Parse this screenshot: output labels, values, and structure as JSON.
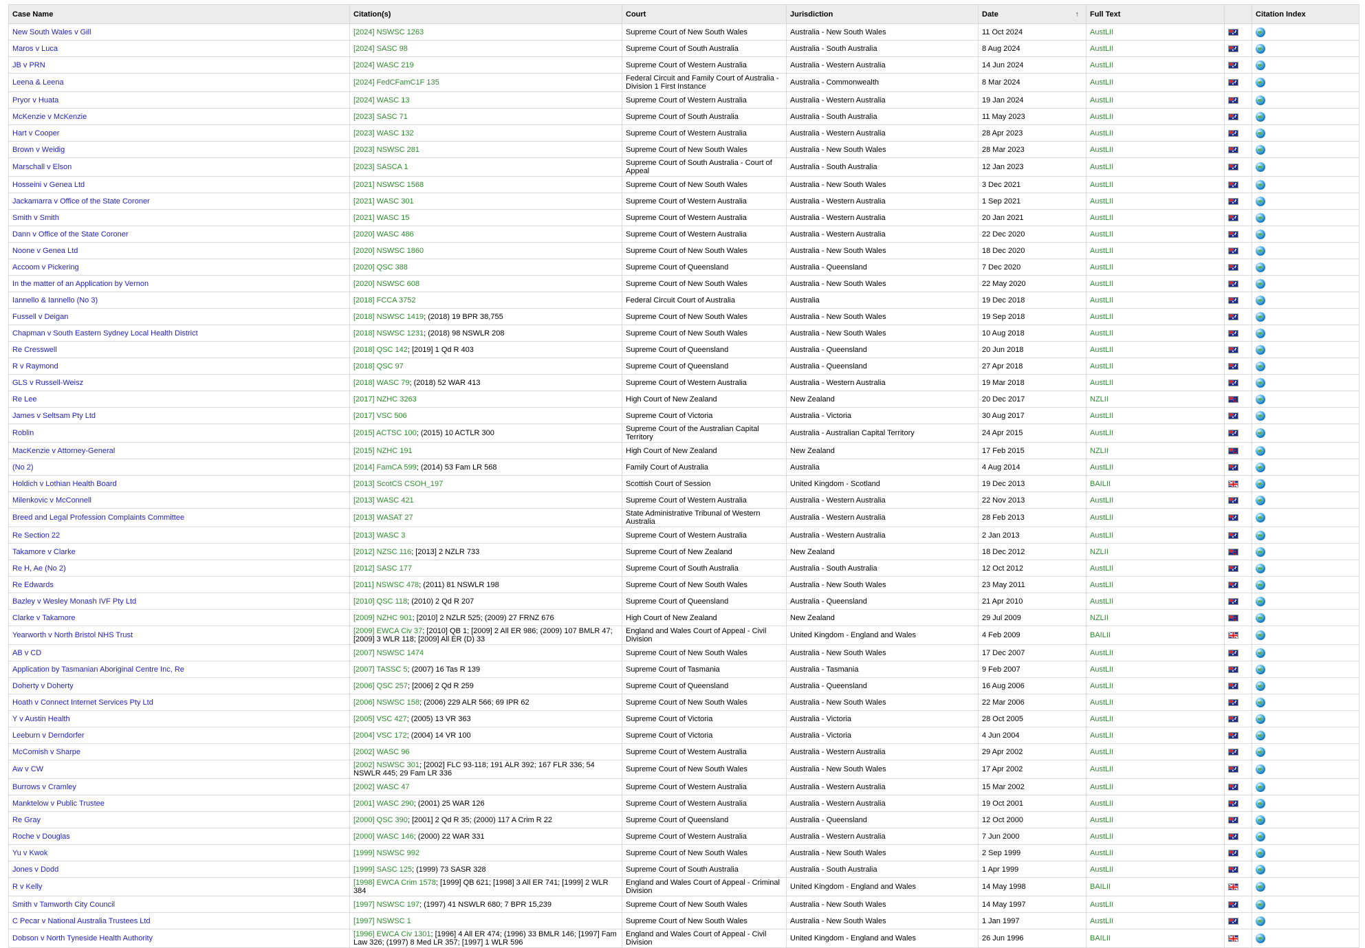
{
  "headers": {
    "case_name": "Case Name",
    "citations": "Citation(s)",
    "court": "Court",
    "jurisdiction": "Jurisdiction",
    "date": "Date",
    "date_sort_icon": "↑",
    "full_text": "Full Text",
    "flag": "",
    "citation_index": "Citation Index"
  },
  "icons": {
    "country_flag": "flag-icon",
    "citation_index": "globe-icon"
  },
  "rows": [
    {
      "name": "New South Wales v Gill",
      "cite_link": "[2024] NSWSC 1263",
      "cite_rest": "",
      "court": "Supreme Court of New South Wales",
      "jurisdiction": "Australia - New South Wales",
      "date": "11 Oct 2024",
      "full_text": "AustLII",
      "flag": "au"
    },
    {
      "name": "Maros v Luca",
      "cite_link": "[2024] SASC 98",
      "cite_rest": "",
      "court": "Supreme Court of South Australia",
      "jurisdiction": "Australia - South Australia",
      "date": "8 Aug 2024",
      "full_text": "AustLII",
      "flag": "au"
    },
    {
      "name": "JB v PRN",
      "cite_link": "[2024] WASC 219",
      "cite_rest": "",
      "court": "Supreme Court of Western Australia",
      "jurisdiction": "Australia - Western Australia",
      "date": "14 Jun 2024",
      "full_text": "AustLII",
      "flag": "au"
    },
    {
      "name": "Leena & Leena",
      "cite_link": "[2024] FedCFamC1F 135",
      "cite_rest": "",
      "court": "Federal Circuit and Family Court of Australia - Division 1 First Instance",
      "jurisdiction": "Australia - Commonwealth",
      "date": "8 Mar 2024",
      "full_text": "AustLII",
      "flag": "au",
      "tall": true
    },
    {
      "name": "Pryor v Huata",
      "cite_link": "[2024] WASC 13",
      "cite_rest": "",
      "court": "Supreme Court of Western Australia",
      "jurisdiction": "Australia - Western Australia",
      "date": "19 Jan 2024",
      "full_text": "AustLII",
      "flag": "au"
    },
    {
      "name": "McKenzie v McKenzie",
      "cite_link": "[2023] SASC 71",
      "cite_rest": "",
      "court": "Supreme Court of South Australia",
      "jurisdiction": "Australia - South Australia",
      "date": "11 May 2023",
      "full_text": "AustLII",
      "flag": "au"
    },
    {
      "name": "Hart v Cooper",
      "cite_link": "[2023] WASC 132",
      "cite_rest": "",
      "court": "Supreme Court of Western Australia",
      "jurisdiction": "Australia - Western Australia",
      "date": "28 Apr 2023",
      "full_text": "AustLII",
      "flag": "au"
    },
    {
      "name": "Brown v Weidig",
      "cite_link": "[2023] NSWSC 281",
      "cite_rest": "",
      "court": "Supreme Court of New South Wales",
      "jurisdiction": "Australia - New South Wales",
      "date": "28 Mar 2023",
      "full_text": "AustLII",
      "flag": "au"
    },
    {
      "name": "Marschall v Elson",
      "cite_link": "[2023] SASCA 1",
      "cite_rest": "",
      "court": "Supreme Court of South Australia - Court of Appeal",
      "jurisdiction": "Australia - South Australia",
      "date": "12 Jan 2023",
      "full_text": "AustLII",
      "flag": "au",
      "tall": true
    },
    {
      "name": "Hosseini v Genea Ltd",
      "cite_link": "[2021] NSWSC 1568",
      "cite_rest": "",
      "court": "Supreme Court of New South Wales",
      "jurisdiction": "Australia - New South Wales",
      "date": "3 Dec 2021",
      "full_text": "AustLII",
      "flag": "au"
    },
    {
      "name": "Jackamarra v Office of the State Coroner",
      "cite_link": "[2021] WASC 301",
      "cite_rest": "",
      "court": "Supreme Court of Western Australia",
      "jurisdiction": "Australia - Western Australia",
      "date": "1 Sep 2021",
      "full_text": "AustLII",
      "flag": "au"
    },
    {
      "name": "Smith v Smith",
      "cite_link": "[2021] WASC 15",
      "cite_rest": "",
      "court": "Supreme Court of Western Australia",
      "jurisdiction": "Australia - Western Australia",
      "date": "20 Jan 2021",
      "full_text": "AustLII",
      "flag": "au"
    },
    {
      "name": "Dann v Office of the State Coroner",
      "cite_link": "[2020] WASC 486",
      "cite_rest": "",
      "court": "Supreme Court of Western Australia",
      "jurisdiction": "Australia - Western Australia",
      "date": "22 Dec 2020",
      "full_text": "AustLII",
      "flag": "au"
    },
    {
      "name": "Noone v Genea Ltd",
      "cite_link": "[2020] NSWSC 1860",
      "cite_rest": "",
      "court": "Supreme Court of New South Wales",
      "jurisdiction": "Australia - New South Wales",
      "date": "18 Dec 2020",
      "full_text": "AustLII",
      "flag": "au"
    },
    {
      "name": "Accoom v Pickering",
      "cite_link": "[2020] QSC 388",
      "cite_rest": "",
      "court": "Supreme Court of Queensland",
      "jurisdiction": "Australia - Queensland",
      "date": "7 Dec 2020",
      "full_text": "AustLII",
      "flag": "au"
    },
    {
      "name": "In the matter of an Application by Vernon",
      "cite_link": "[2020] NSWSC 608",
      "cite_rest": "",
      "court": "Supreme Court of New South Wales",
      "jurisdiction": "Australia - New South Wales",
      "date": "22 May 2020",
      "full_text": "AustLII",
      "flag": "au"
    },
    {
      "name": "Iannello & Iannello (No 3)",
      "cite_link": "[2018] FCCA 3752",
      "cite_rest": "",
      "court": "Federal Circuit Court of Australia",
      "jurisdiction": "Australia",
      "date": "19 Dec 2018",
      "full_text": "AustLII",
      "flag": "au"
    },
    {
      "name": "Fussell v Deigan",
      "cite_link": "[2018] NSWSC 1419",
      "cite_rest": "; (2018) 19 BPR 38,755",
      "court": "Supreme Court of New South Wales",
      "jurisdiction": "Australia - New South Wales",
      "date": "19 Sep 2018",
      "full_text": "AustLII",
      "flag": "au"
    },
    {
      "name": "Chapman v South Eastern Sydney Local Health District",
      "cite_link": "[2018] NSWSC 1231",
      "cite_rest": "; (2018) 98 NSWLR 208",
      "court": "Supreme Court of New South Wales",
      "jurisdiction": "Australia - New South Wales",
      "date": "10 Aug 2018",
      "full_text": "AustLII",
      "flag": "au"
    },
    {
      "name": "Re Cresswell",
      "cite_link": "[2018] QSC 142",
      "cite_rest": "; [2019] 1 Qd R 403",
      "court": "Supreme Court of Queensland",
      "jurisdiction": "Australia - Queensland",
      "date": "20 Jun 2018",
      "full_text": "AustLII",
      "flag": "au"
    },
    {
      "name": "R v Raymond",
      "cite_link": "[2018] QSC 97",
      "cite_rest": "",
      "court": "Supreme Court of Queensland",
      "jurisdiction": "Australia - Queensland",
      "date": "27 Apr 2018",
      "full_text": "AustLII",
      "flag": "au"
    },
    {
      "name": "GLS v Russell-Weisz",
      "cite_link": "[2018] WASC 79",
      "cite_rest": "; (2018) 52 WAR 413",
      "court": "Supreme Court of Western Australia",
      "jurisdiction": "Australia - Western Australia",
      "date": "19 Mar 2018",
      "full_text": "AustLII",
      "flag": "au"
    },
    {
      "name": "Re Lee",
      "cite_link": "[2017] NZHC 3263",
      "cite_rest": "",
      "court": "High Court of New Zealand",
      "jurisdiction": "New Zealand",
      "date": "20 Dec 2017",
      "full_text": "NZLII",
      "flag": "nz"
    },
    {
      "name": "James v Seltsam Pty Ltd",
      "cite_link": "[2017] VSC 506",
      "cite_rest": "",
      "court": "Supreme Court of Victoria",
      "jurisdiction": "Australia - Victoria",
      "date": "30 Aug 2017",
      "full_text": "AustLII",
      "flag": "au"
    },
    {
      "name": "Roblin",
      "cite_link": "[2015] ACTSC 100",
      "cite_rest": "; (2015) 10 ACTLR 300",
      "court": "Supreme Court of the Australian Capital Territory",
      "jurisdiction": "Australia - Australian Capital Territory",
      "date": "24 Apr 2015",
      "full_text": "AustLII",
      "flag": "au",
      "tall": true
    },
    {
      "name": "MacKenzie v Attorney-General",
      "cite_link": "[2015] NZHC 191",
      "cite_rest": "",
      "court": "High Court of New Zealand",
      "jurisdiction": "New Zealand",
      "date": "17 Feb 2015",
      "full_text": "NZLII",
      "flag": "nz"
    },
    {
      "name": "(No 2)",
      "cite_link": "[2014] FamCA 599",
      "cite_rest": "; (2014) 53 Fam LR 568",
      "court": "Family Court of Australia",
      "jurisdiction": "Australia",
      "date": "4 Aug 2014",
      "full_text": "AustLII",
      "flag": "au"
    },
    {
      "name": "Holdich v Lothian Health Board",
      "cite_link": "[2013] ScotCS CSOH_197",
      "cite_rest": "",
      "court": "Scottish Court of Session",
      "jurisdiction": "United Kingdom - Scotland",
      "date": "19 Dec 2013",
      "full_text": "BAILII",
      "flag": "uk"
    },
    {
      "name": "Milenkovic v McConnell",
      "cite_link": "[2013] WASC 421",
      "cite_rest": "",
      "court": "Supreme Court of Western Australia",
      "jurisdiction": "Australia - Western Australia",
      "date": "22 Nov 2013",
      "full_text": "AustLII",
      "flag": "au"
    },
    {
      "name": "Breed and Legal Profession Complaints Committee",
      "cite_link": "[2013] WASAT 27",
      "cite_rest": "",
      "court": "State Administrative Tribunal of Western Australia",
      "jurisdiction": "Australia - Western Australia",
      "date": "28 Feb 2013",
      "full_text": "AustLII",
      "flag": "au",
      "tall": true
    },
    {
      "name": "Re Section 22",
      "cite_link": "[2013] WASC 3",
      "cite_rest": "",
      "court": "Supreme Court of Western Australia",
      "jurisdiction": "Australia - Western Australia",
      "date": "2 Jan 2013",
      "full_text": "AustLII",
      "flag": "au"
    },
    {
      "name": "Takamore v Clarke",
      "cite_link": "[2012] NZSC 116",
      "cite_rest": "; [2013] 2 NZLR 733",
      "court": "Supreme Court of New Zealand",
      "jurisdiction": "New Zealand",
      "date": "18 Dec 2012",
      "full_text": "NZLII",
      "flag": "nz"
    },
    {
      "name": "Re H, Ae (No 2)",
      "cite_link": "[2012] SASC 177",
      "cite_rest": "",
      "court": "Supreme Court of South Australia",
      "jurisdiction": "Australia - South Australia",
      "date": "12 Oct 2012",
      "full_text": "AustLII",
      "flag": "au"
    },
    {
      "name": "Re Edwards",
      "cite_link": "[2011] NSWSC 478",
      "cite_rest": "; (2011) 81 NSWLR 198",
      "court": "Supreme Court of New South Wales",
      "jurisdiction": "Australia - New South Wales",
      "date": "23 May 2011",
      "full_text": "AustLII",
      "flag": "au"
    },
    {
      "name": "Bazley v Wesley Monash IVF Pty Ltd",
      "cite_link": "[2010] QSC 118",
      "cite_rest": "; (2010) 2 Qd R 207",
      "court": "Supreme Court of Queensland",
      "jurisdiction": "Australia - Queensland",
      "date": "21 Apr 2010",
      "full_text": "AustLII",
      "flag": "au"
    },
    {
      "name": "Clarke v Takamore",
      "cite_link": "[2009] NZHC 901",
      "cite_rest": "; [2010] 2 NZLR 525; (2009) 27 FRNZ 676",
      "court": "High Court of New Zealand",
      "jurisdiction": "New Zealand",
      "date": "29 Jul 2009",
      "full_text": "NZLII",
      "flag": "nz"
    },
    {
      "name": "Yearworth v North Bristol NHS Trust",
      "cite_link": "[2009] EWCA Civ 37",
      "cite_rest": "; [2010] QB 1; [2009] 2 All ER 986; (2009) 107 BMLR 47; [2009] 3 WLR 118; [2009] All ER (D) 33",
      "court": "England and Wales Court of Appeal - Civil Division",
      "jurisdiction": "United Kingdom - England and Wales",
      "date": "4 Feb 2009",
      "full_text": "BAILII",
      "flag": "uk",
      "tall": true
    },
    {
      "name": "AB v CD",
      "cite_link": "[2007] NSWSC 1474",
      "cite_rest": "",
      "court": "Supreme Court of New South Wales",
      "jurisdiction": "Australia - New South Wales",
      "date": "17 Dec 2007",
      "full_text": "AustLII",
      "flag": "au"
    },
    {
      "name": "Application by Tasmanian Aboriginal Centre Inc, Re",
      "cite_link": "[2007] TASSC 5",
      "cite_rest": "; (2007) 16 Tas R 139",
      "court": "Supreme Court of Tasmania",
      "jurisdiction": "Australia - Tasmania",
      "date": "9 Feb 2007",
      "full_text": "AustLII",
      "flag": "au"
    },
    {
      "name": "Doherty v Doherty",
      "cite_link": "[2006] QSC 257",
      "cite_rest": "; [2006] 2 Qd R 259",
      "court": "Supreme Court of Queensland",
      "jurisdiction": "Australia - Queensland",
      "date": "16 Aug 2006",
      "full_text": "AustLII",
      "flag": "au"
    },
    {
      "name": "Hoath v Connect Internet Services Pty Ltd",
      "cite_link": "[2006] NSWSC 158",
      "cite_rest": "; (2006) 229 ALR 566; 69 IPR 62",
      "court": "Supreme Court of New South Wales",
      "jurisdiction": "Australia - New South Wales",
      "date": "22 Mar 2006",
      "full_text": "AustLII",
      "flag": "au"
    },
    {
      "name": "Y v Austin Health",
      "cite_link": "[2005] VSC 427",
      "cite_rest": "; (2005) 13 VR 363",
      "court": "Supreme Court of Victoria",
      "jurisdiction": "Australia - Victoria",
      "date": "28 Oct 2005",
      "full_text": "AustLII",
      "flag": "au"
    },
    {
      "name": "Leeburn v Derndorfer",
      "cite_link": "[2004] VSC 172",
      "cite_rest": "; (2004) 14 VR 100",
      "court": "Supreme Court of Victoria",
      "jurisdiction": "Australia - Victoria",
      "date": "4 Jun 2004",
      "full_text": "AustLII",
      "flag": "au"
    },
    {
      "name": "McComish v Sharpe",
      "cite_link": "[2002] WASC 96",
      "cite_rest": "",
      "court": "Supreme Court of Western Australia",
      "jurisdiction": "Australia - Western Australia",
      "date": "29 Apr 2002",
      "full_text": "AustLII",
      "flag": "au"
    },
    {
      "name": "Aw v CW",
      "cite_link": "[2002] NSWSC 301",
      "cite_rest": "; [2002] FLC 93-118; 191 ALR 392; 167 FLR 336; 54 NSWLR 445; 29 Fam LR 336",
      "court": "Supreme Court of New South Wales",
      "jurisdiction": "Australia - New South Wales",
      "date": "17 Apr 2002",
      "full_text": "AustLII",
      "flag": "au",
      "tall": true
    },
    {
      "name": "Burrows v Cramley",
      "cite_link": "[2002] WASC 47",
      "cite_rest": "",
      "court": "Supreme Court of Western Australia",
      "jurisdiction": "Australia - Western Australia",
      "date": "15 Mar 2002",
      "full_text": "AustLII",
      "flag": "au"
    },
    {
      "name": "Manktelow v Public Trustee",
      "cite_link": "[2001] WASC 290",
      "cite_rest": "; (2001) 25 WAR 126",
      "court": "Supreme Court of Western Australia",
      "jurisdiction": "Australia - Western Australia",
      "date": "19 Oct 2001",
      "full_text": "AustLII",
      "flag": "au"
    },
    {
      "name": "Re Gray",
      "cite_link": "[2000] QSC 390",
      "cite_rest": "; [2001] 2 Qd R 35; (2000) 117 A Crim R 22",
      "court": "Supreme Court of Queensland",
      "jurisdiction": "Australia - Queensland",
      "date": "12 Oct 2000",
      "full_text": "AustLII",
      "flag": "au"
    },
    {
      "name": "Roche v Douglas",
      "cite_link": "[2000] WASC 146",
      "cite_rest": "; (2000) 22 WAR 331",
      "court": "Supreme Court of Western Australia",
      "jurisdiction": "Australia - Western Australia",
      "date": "7 Jun 2000",
      "full_text": "AustLII",
      "flag": "au"
    },
    {
      "name": "Yu v Kwok",
      "cite_link": "[1999] NSWSC 992",
      "cite_rest": "",
      "court": "Supreme Court of New South Wales",
      "jurisdiction": "Australia - New South Wales",
      "date": "2 Sep 1999",
      "full_text": "AustLII",
      "flag": "au"
    },
    {
      "name": "Jones v Dodd",
      "cite_link": "[1999] SASC 125",
      "cite_rest": "; (1999) 73 SASR 328",
      "court": "Supreme Court of South Australia",
      "jurisdiction": "Australia - South Australia",
      "date": "1 Apr 1999",
      "full_text": "AustLII",
      "flag": "au"
    },
    {
      "name": "R v Kelly",
      "cite_link": "[1998] EWCA Crim 1578",
      "cite_rest": "; [1999] QB 621; [1998] 3 All ER 741; [1999] 2 WLR 384",
      "court": "England and Wales Court of Appeal - Criminal Division",
      "jurisdiction": "United Kingdom - England and Wales",
      "date": "14 May 1998",
      "full_text": "BAILII",
      "flag": "uk",
      "tall": true
    },
    {
      "name": "Smith v Tamworth City Council",
      "cite_link": "[1997] NSWSC 197",
      "cite_rest": "; (1997) 41 NSWLR 680; 7 BPR 15,239",
      "court": "Supreme Court of New South Wales",
      "jurisdiction": "Australia - New South Wales",
      "date": "14 May 1997",
      "full_text": "AustLII",
      "flag": "au"
    },
    {
      "name": "C Pecar v National Australia Trustees Ltd",
      "cite_link": "[1997] NSWSC 1",
      "cite_rest": "",
      "court": "Supreme Court of New South Wales",
      "jurisdiction": "Australia - New South Wales",
      "date": "1 Jan 1997",
      "full_text": "AustLII",
      "flag": "au"
    },
    {
      "name": "Dobson v North Tyneside Health Authority",
      "cite_link": "[1996] EWCA Civ 1301",
      "cite_rest": "; [1996] 4 All ER 474; (1996) 33 BMLR 146; [1997] Fam Law 326; (1997) 8 Med LR 357; [1997] 1 WLR 596",
      "court": "England and Wales Court of Appeal - Civil Division",
      "jurisdiction": "United Kingdom - England and Wales",
      "date": "26 Jun 1996",
      "full_text": "BAILII",
      "flag": "uk",
      "tall": true
    }
  ]
}
